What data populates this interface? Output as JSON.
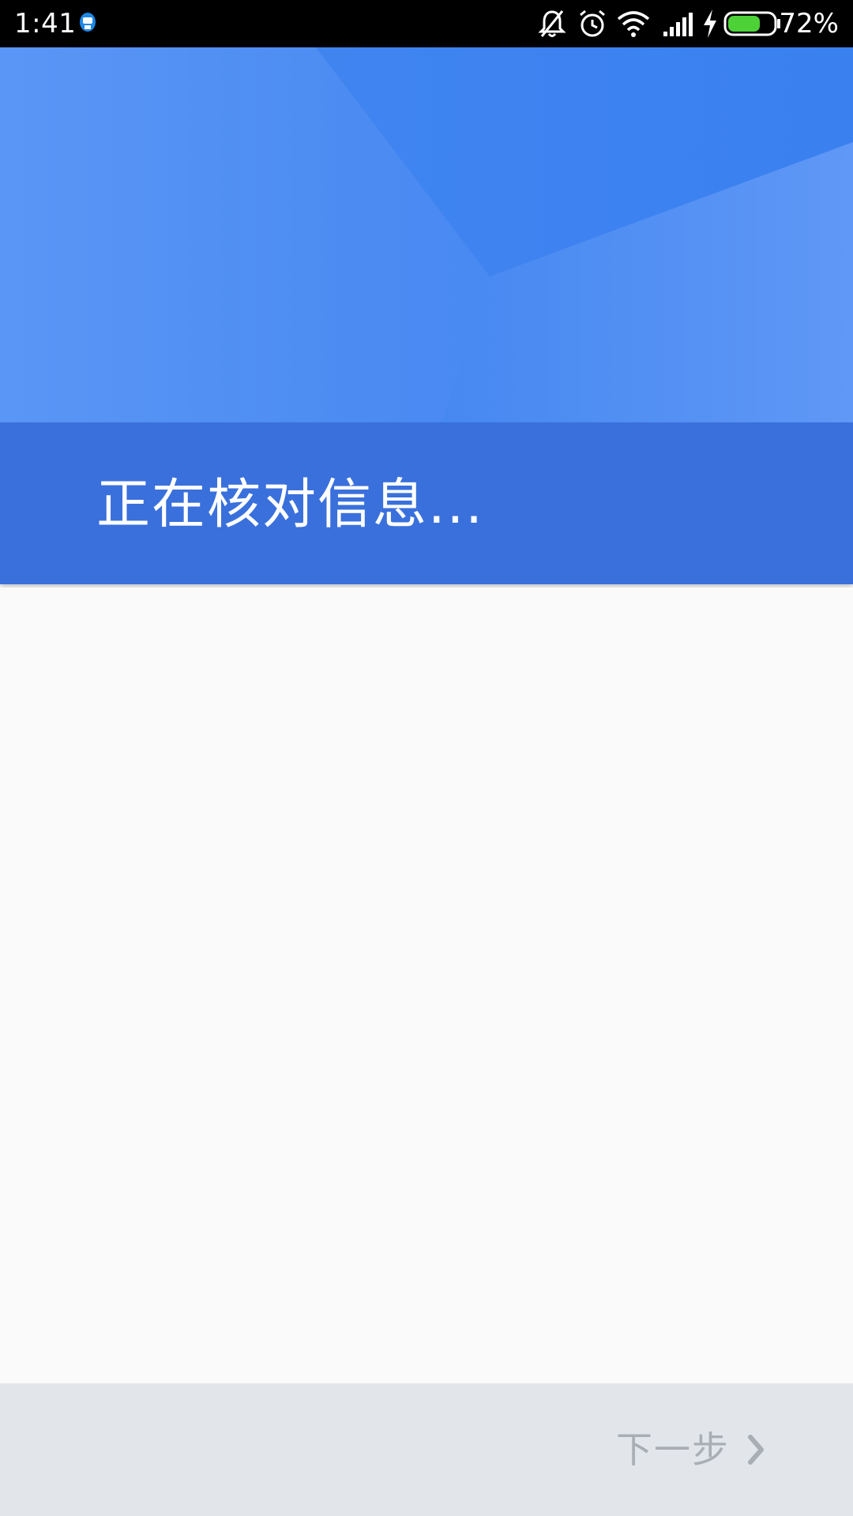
{
  "status_bar": {
    "time": "1:41",
    "battery_percent": "72%",
    "battery_level": 0.72,
    "battery_color": "#4cd137",
    "icons": [
      "notification-icon",
      "mute-bell-icon",
      "alarm-icon",
      "wifi-icon",
      "signal-icon",
      "charging-icon",
      "battery-icon"
    ]
  },
  "header": {
    "title": "正在核对信息...",
    "hero_color": "#4a8af2",
    "band_color": "#3a70dc"
  },
  "bottom_bar": {
    "next_label": "下一步",
    "next_icon": "chevron-right-icon",
    "background": "#e2e6ea"
  }
}
